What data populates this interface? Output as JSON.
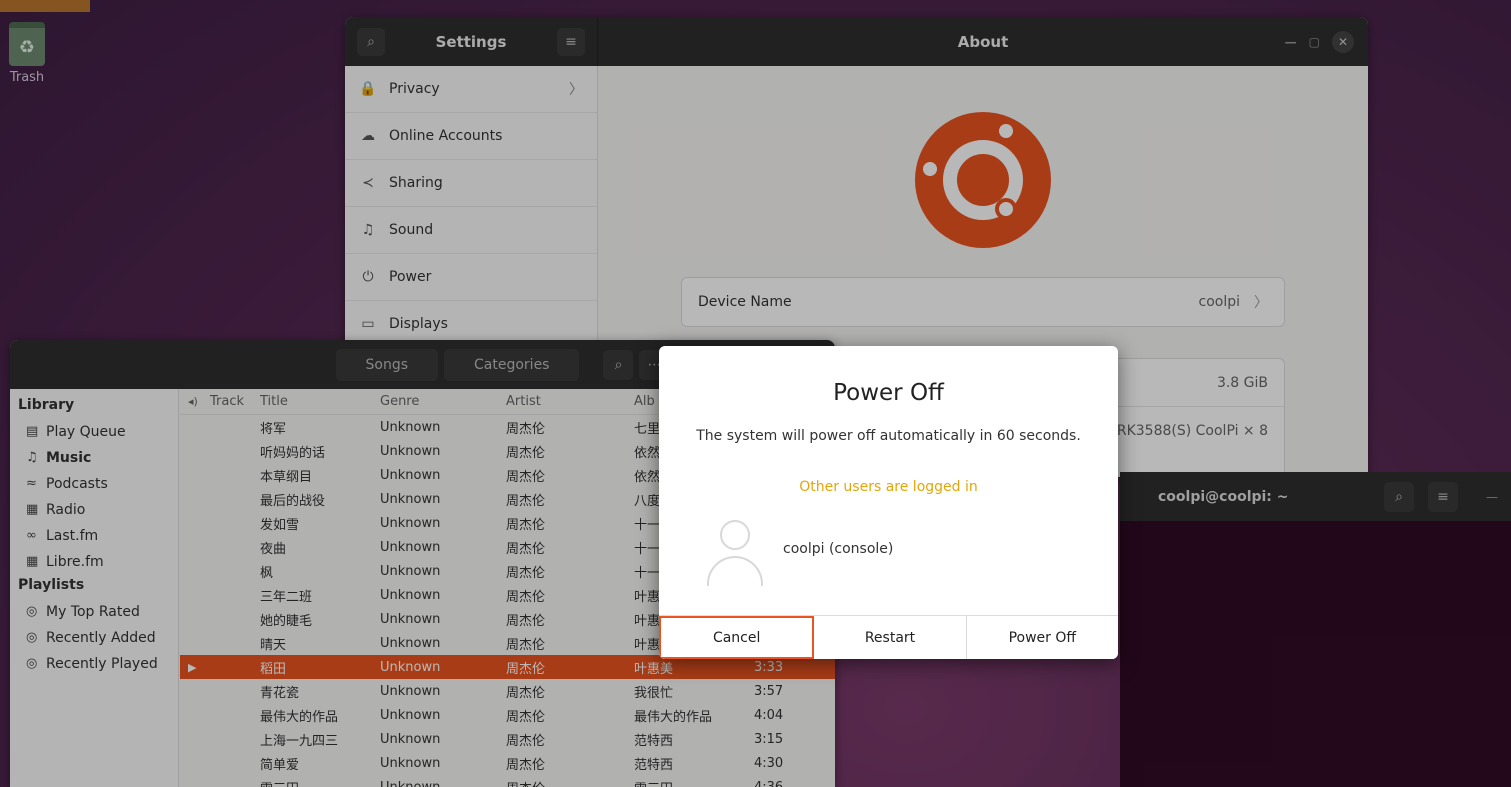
{
  "desktop": {
    "trash_label": "Trash"
  },
  "settings": {
    "sidebar_title": "Settings",
    "page_title": "About",
    "sidebar_items": [
      {
        "label": "Privacy",
        "icon": "lock-icon",
        "glyph": "🔒"
      },
      {
        "label": "Online Accounts",
        "icon": "cloud-icon",
        "glyph": "☁"
      },
      {
        "label": "Sharing",
        "icon": "share-icon",
        "glyph": "≺"
      },
      {
        "label": "Sound",
        "icon": "music-note-icon",
        "glyph": "♫"
      },
      {
        "label": "Power",
        "icon": "power-icon",
        "glyph": "⏻"
      },
      {
        "label": "Displays",
        "icon": "display-icon",
        "glyph": "▭"
      }
    ],
    "device_name_label": "Device Name",
    "device_name_value": "coolpi",
    "memory_value": "3.8 GiB",
    "processor_value": "RK3588(S) CoolPi × 8",
    "accent": "#e95420"
  },
  "music": {
    "tabs": [
      "Songs",
      "Categories"
    ],
    "library_heading": "Library",
    "library_items": [
      {
        "label": "Play Queue",
        "glyph": "▤",
        "bold": false
      },
      {
        "label": "Music",
        "glyph": "♫",
        "bold": true
      },
      {
        "label": "Podcasts",
        "glyph": "≈",
        "bold": false
      },
      {
        "label": "Radio",
        "glyph": "▦",
        "bold": false
      },
      {
        "label": "Last.fm",
        "glyph": "∞",
        "bold": false
      },
      {
        "label": "Libre.fm",
        "glyph": "▦",
        "bold": false
      }
    ],
    "playlists_heading": "Playlists",
    "playlist_items": [
      {
        "label": "My Top Rated",
        "glyph": "◎"
      },
      {
        "label": "Recently Added",
        "glyph": "◎"
      },
      {
        "label": "Recently Played",
        "glyph": "◎"
      }
    ],
    "columns": {
      "track": "Track",
      "title": "Title",
      "genre": "Genre",
      "artist": "Artist",
      "album": "Alb"
    },
    "rows": [
      {
        "title": "将军",
        "genre": "Unknown",
        "artist": "周杰伦",
        "album": "七里",
        "time": "",
        "playing": false
      },
      {
        "title": "听妈妈的话",
        "genre": "Unknown",
        "artist": "周杰伦",
        "album": "依然",
        "time": "",
        "playing": false
      },
      {
        "title": "本草纲目",
        "genre": "Unknown",
        "artist": "周杰伦",
        "album": "依然",
        "time": "",
        "playing": false
      },
      {
        "title": "最后的战役",
        "genre": "Unknown",
        "artist": "周杰伦",
        "album": "八度",
        "time": "",
        "playing": false
      },
      {
        "title": "发如雪",
        "genre": "Unknown",
        "artist": "周杰伦",
        "album": "十一",
        "time": "",
        "playing": false
      },
      {
        "title": "夜曲",
        "genre": "Unknown",
        "artist": "周杰伦",
        "album": "十一",
        "time": "",
        "playing": false
      },
      {
        "title": "枫",
        "genre": "Unknown",
        "artist": "周杰伦",
        "album": "十一",
        "time": "",
        "playing": false
      },
      {
        "title": "三年二班",
        "genre": "Unknown",
        "artist": "周杰伦",
        "album": "叶惠",
        "time": "",
        "playing": false
      },
      {
        "title": "她的睫毛",
        "genre": "Unknown",
        "artist": "周杰伦",
        "album": "叶惠",
        "time": "",
        "playing": false
      },
      {
        "title": "晴天",
        "genre": "Unknown",
        "artist": "周杰伦",
        "album": "叶惠",
        "time": "",
        "playing": false
      },
      {
        "title": "稻田",
        "genre": "Unknown",
        "artist": "周杰伦",
        "album": "叶惠美",
        "time": "3:33",
        "playing": true
      },
      {
        "title": "青花瓷",
        "genre": "Unknown",
        "artist": "周杰伦",
        "album": "我很忙",
        "time": "3:57",
        "playing": false
      },
      {
        "title": "最伟大的作品",
        "genre": "Unknown",
        "artist": "周杰伦",
        "album": "最伟大的作品",
        "time": "4:04",
        "playing": false
      },
      {
        "title": "上海一九四三",
        "genre": "Unknown",
        "artist": "周杰伦",
        "album": "范特西",
        "time": "3:15",
        "playing": false
      },
      {
        "title": "简单爱",
        "genre": "Unknown",
        "artist": "周杰伦",
        "album": "范特西",
        "time": "4:30",
        "playing": false
      },
      {
        "title": "雪三田",
        "genre": "Unknown",
        "artist": "周杰伦",
        "album": "雪三田",
        "time": "4:36",
        "playing": false
      }
    ]
  },
  "terminal": {
    "title": "coolpi@coolpi: ~"
  },
  "dialog": {
    "title": "Power Off",
    "message": "The system will power off automatically in 60 seconds.",
    "warning": "Other users are logged in",
    "user": "coolpi (console)",
    "buttons": {
      "cancel": "Cancel",
      "restart": "Restart",
      "power_off": "Power Off"
    },
    "warning_color": "#e5a50a"
  }
}
